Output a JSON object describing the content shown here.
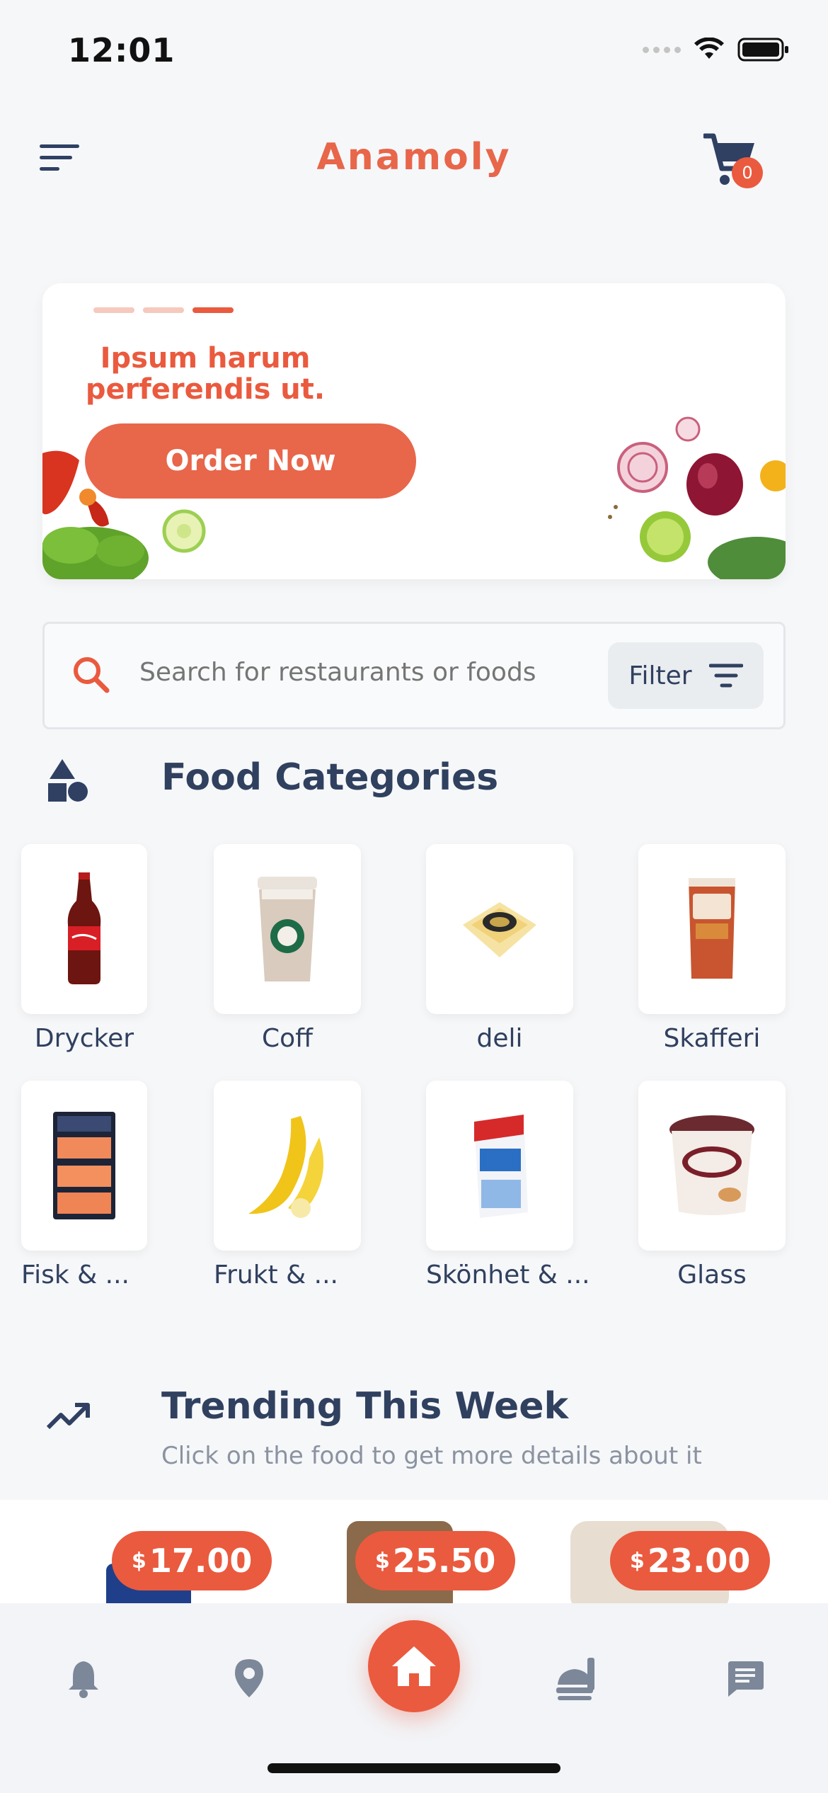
{
  "status_bar": {
    "time": "12:01"
  },
  "header": {
    "title": "Anamoly",
    "cart_count": "0"
  },
  "banner": {
    "headline": "Ipsum harum perferendis ut.",
    "button_label": "Order Now",
    "slides": 3,
    "active_slide": 3
  },
  "search": {
    "placeholder": "Search for restaurants or foods",
    "filter_label": "Filter"
  },
  "categories": {
    "title": "Food Categories",
    "items": [
      {
        "label": "Drycker"
      },
      {
        "label": "Coff"
      },
      {
        "label": "deli"
      },
      {
        "label": "Skafferi"
      },
      {
        "label": "Fisk & ..."
      },
      {
        "label": "Frukt & ..."
      },
      {
        "label": "Skönhet & ..."
      },
      {
        "label": "Glass"
      }
    ]
  },
  "trending": {
    "title": "Trending This Week",
    "subtitle": "Click on the food to get more details about it",
    "items": [
      {
        "currency": "$",
        "price": "17.00"
      },
      {
        "currency": "$",
        "price": "25.50"
      },
      {
        "currency": "$",
        "price": "23.00"
      }
    ]
  },
  "tabbar": {
    "tabs": [
      "bell-icon",
      "location-pin-icon",
      "home-icon",
      "food-icon",
      "chat-icon"
    ],
    "active": "home-icon"
  },
  "colors": {
    "accent": "#ea5a3e",
    "text": "#30405f",
    "background": "#f6f7f9"
  }
}
